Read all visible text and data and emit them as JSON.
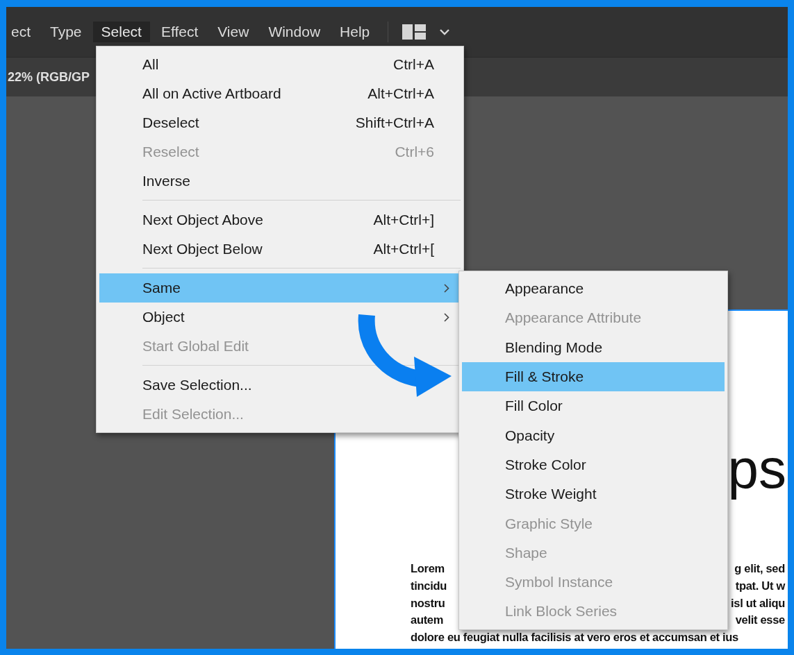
{
  "menubar": {
    "items": [
      {
        "label": "ect",
        "selected": false
      },
      {
        "label": "Type",
        "selected": false
      },
      {
        "label": "Select",
        "selected": true
      },
      {
        "label": "Effect",
        "selected": false
      },
      {
        "label": "View",
        "selected": false
      },
      {
        "label": "Window",
        "selected": false
      },
      {
        "label": "Help",
        "selected": false
      }
    ]
  },
  "document_tab": {
    "title": "22% (RGB/GP"
  },
  "select_menu": {
    "items": [
      {
        "kind": "item",
        "label": "All",
        "shortcut": "Ctrl+A",
        "disabled": false,
        "selected": false,
        "submenu": false
      },
      {
        "kind": "item",
        "label": "All on Active Artboard",
        "shortcut": "Alt+Ctrl+A",
        "disabled": false,
        "selected": false,
        "submenu": false
      },
      {
        "kind": "item",
        "label": "Deselect",
        "shortcut": "Shift+Ctrl+A",
        "disabled": false,
        "selected": false,
        "submenu": false
      },
      {
        "kind": "item",
        "label": "Reselect",
        "shortcut": "Ctrl+6",
        "disabled": true,
        "selected": false,
        "submenu": false
      },
      {
        "kind": "item",
        "label": "Inverse",
        "disabled": false,
        "selected": false,
        "submenu": false
      },
      {
        "kind": "separator"
      },
      {
        "kind": "item",
        "label": "Next Object Above",
        "shortcut": "Alt+Ctrl+]",
        "disabled": false,
        "selected": false,
        "submenu": false
      },
      {
        "kind": "item",
        "label": "Next Object Below",
        "shortcut": "Alt+Ctrl+[",
        "disabled": false,
        "selected": false,
        "submenu": false
      },
      {
        "kind": "separator"
      },
      {
        "kind": "item",
        "label": "Same",
        "disabled": false,
        "selected": true,
        "submenu": true
      },
      {
        "kind": "item",
        "label": "Object",
        "disabled": false,
        "selected": false,
        "submenu": true
      },
      {
        "kind": "item",
        "label": "Start Global Edit",
        "disabled": true,
        "selected": false,
        "submenu": false
      },
      {
        "kind": "separator"
      },
      {
        "kind": "item",
        "label": "Save Selection...",
        "disabled": false,
        "selected": false,
        "submenu": false
      },
      {
        "kind": "item",
        "label": "Edit Selection...",
        "disabled": true,
        "selected": false,
        "submenu": false
      }
    ]
  },
  "same_submenu": {
    "items": [
      {
        "label": "Appearance",
        "disabled": false,
        "selected": false
      },
      {
        "label": "Appearance Attribute",
        "disabled": true,
        "selected": false
      },
      {
        "label": "Blending Mode",
        "disabled": false,
        "selected": false
      },
      {
        "label": "Fill & Stroke",
        "disabled": false,
        "selected": true
      },
      {
        "label": "Fill Color",
        "disabled": false,
        "selected": false
      },
      {
        "label": "Opacity",
        "disabled": false,
        "selected": false
      },
      {
        "label": "Stroke Color",
        "disabled": false,
        "selected": false
      },
      {
        "label": "Stroke Weight",
        "disabled": false,
        "selected": false
      },
      {
        "label": "Graphic Style",
        "disabled": true,
        "selected": false
      },
      {
        "label": "Shape",
        "disabled": true,
        "selected": false
      },
      {
        "label": "Symbol Instance",
        "disabled": true,
        "selected": false
      },
      {
        "label": "Link Block Series",
        "disabled": true,
        "selected": false
      }
    ]
  },
  "artboard": {
    "heading": "ps",
    "lines": [
      {
        "left": "Lorem",
        "right": "g elit, sed"
      },
      {
        "left": "tincidu",
        "right": "tpat. Ut w"
      },
      {
        "left": "nostru",
        "right": "isl ut aliqu"
      },
      {
        "left": "autem",
        "right": "velit esse"
      },
      {
        "left": "dolore eu feugiat nulla facilisis at vero eros et accumsan et ius"
      }
    ]
  }
}
